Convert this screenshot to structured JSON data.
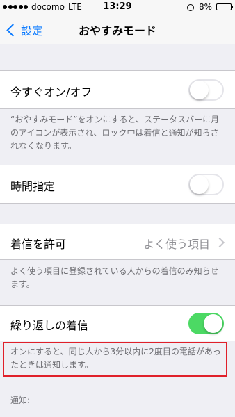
{
  "status_bar": {
    "carrier": "docomo",
    "network": "LTE",
    "time": "13:29",
    "battery": "8%",
    "battery_level": 0.08,
    "signal_dots": 5,
    "alarm_icon": "alarm-icon"
  },
  "nav": {
    "back_label": "設定",
    "title": "おやすみモード"
  },
  "groups": {
    "manual": {
      "label": "今すぐオン/オフ",
      "switch_on": false,
      "footer": "“おやすみモード”をオンにすると、ステータスバーに月のアイコンが表示され、ロック中は着信と通知が知らされなくなります。"
    },
    "scheduled": {
      "label": "時間指定",
      "switch_on": false
    },
    "allow_calls": {
      "label": "着信を許可",
      "value": "よく使う項目",
      "footer": "よく使う項目に登録されている人からの着信のみ知らせます。"
    },
    "repeated_calls": {
      "label": "繰り返しの着信",
      "switch_on": true,
      "footer": "オンにすると、同じ人から3分以内に2度目の電話があったときは通知します。"
    }
  },
  "notifications_header": "通知:",
  "colors": {
    "accent": "#0a7aff",
    "switch_on": "#4cd964",
    "highlight": "#e0202a",
    "background": "#efeff4"
  }
}
